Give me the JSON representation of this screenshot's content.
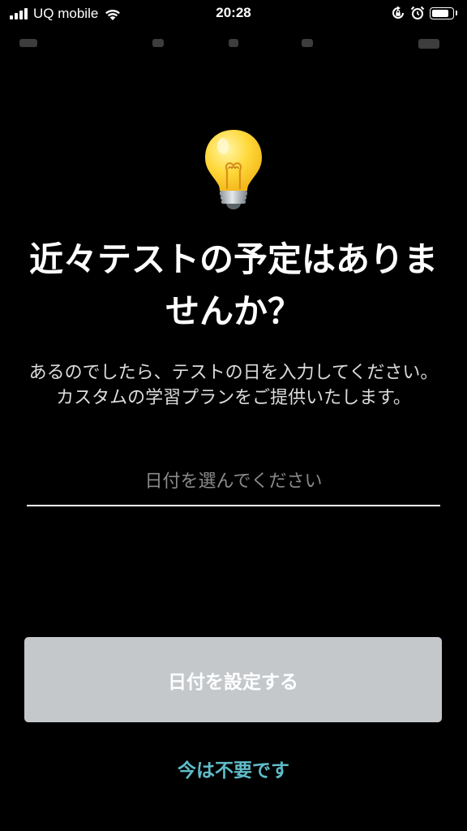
{
  "status_bar": {
    "carrier": "UQ mobile",
    "time": "20:28",
    "signal_icon": "signal-bars-icon",
    "wifi_icon": "wifi-icon",
    "rotation_lock_icon": "rotation-lock-icon",
    "alarm_icon": "alarm-clock-icon",
    "battery_icon": "battery-icon",
    "battery_level": 0.85
  },
  "prompt": {
    "icon": "light-bulb-icon",
    "title": "近々テストの予定はありませんか？",
    "description": "あるのでしたら、テストの日を入力してください。カスタムの学習プランをご提供いたします。"
  },
  "date_field": {
    "placeholder": "日付を選んでください"
  },
  "actions": {
    "set_date_label": "日付を設定する",
    "skip_label": "今は不要です"
  },
  "colors": {
    "background": "#000000",
    "button_disabled": "#c4c8cb",
    "link_accent": "#5fbcc8",
    "placeholder_text": "#8a8a8a"
  }
}
